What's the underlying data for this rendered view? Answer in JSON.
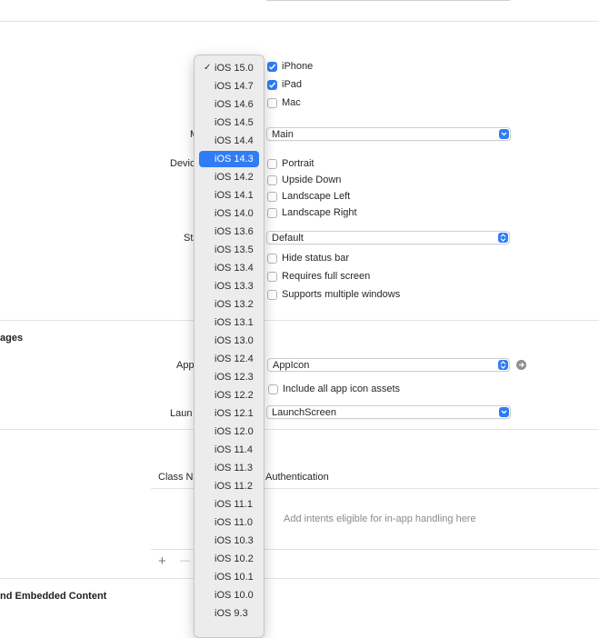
{
  "deployment": {
    "devices": [
      {
        "label": "iPhone",
        "checked": true
      },
      {
        "label": "iPad",
        "checked": true
      },
      {
        "label": "Mac",
        "checked": false
      }
    ],
    "main_interface_label_partial": "M",
    "main_interface_value": "Main",
    "device_orientation_label_partial": "Devic",
    "orientations": [
      {
        "label": "Portrait",
        "checked": false
      },
      {
        "label": "Upside Down",
        "checked": false
      },
      {
        "label": "Landscape Left",
        "checked": false
      },
      {
        "label": "Landscape Right",
        "checked": false
      }
    ],
    "status_bar_label_partial": "St",
    "status_bar_value": "Default",
    "status_options": [
      {
        "label": "Hide status bar",
        "checked": false
      },
      {
        "label": "Requires full screen",
        "checked": false
      },
      {
        "label": "Supports multiple windows",
        "checked": false
      }
    ]
  },
  "app_icons": {
    "section_title_partial": "ages",
    "app_icon_label_partial": "App",
    "app_icon_value": "AppIcon",
    "include_all_label": "Include all app icon assets",
    "launch_label_partial": "Laun",
    "launch_value": "LaunchScreen"
  },
  "intents": {
    "class_name_header_partial": "Class N",
    "authentication_header": "Authentication",
    "empty_text": "Add intents eligible for in-app handling here",
    "add_symbol": "+",
    "remove_symbol": "—"
  },
  "embedded": {
    "section_title_partial": "nd Embedded Content"
  },
  "ios_menu": {
    "checked_item": "iOS 15.0",
    "selected_item": "iOS 14.3",
    "items": [
      "iOS 15.0",
      "iOS 14.7",
      "iOS 14.6",
      "iOS 14.5",
      "iOS 14.4",
      "iOS 14.3",
      "iOS 14.2",
      "iOS 14.1",
      "iOS 14.0",
      "iOS 13.6",
      "iOS 13.5",
      "iOS 13.4",
      "iOS 13.3",
      "iOS 13.2",
      "iOS 13.1",
      "iOS 13.0",
      "iOS 12.4",
      "iOS 12.3",
      "iOS 12.2",
      "iOS 12.1",
      "iOS 12.0",
      "iOS 11.4",
      "iOS 11.3",
      "iOS 11.2",
      "iOS 11.1",
      "iOS 11.0",
      "iOS 10.3",
      "iOS 10.2",
      "iOS 10.1",
      "iOS 10.0",
      "iOS 9.3"
    ]
  },
  "colors": {
    "accent": "#2f7cf6",
    "menu_bg": "#ececec",
    "divider": "#e3e3e3"
  }
}
